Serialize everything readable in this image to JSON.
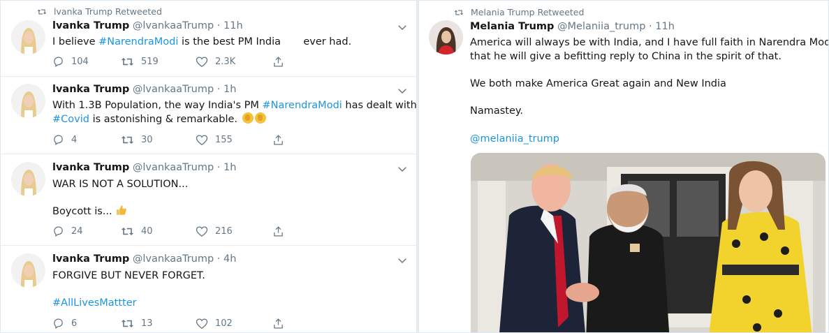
{
  "left_column": {
    "tweets": [
      {
        "retweet_label": "lvanka Trump Retweeted",
        "name": "lvanka Trump",
        "handle": "@lvankaaTrump",
        "dot": "·",
        "time": "11h",
        "text_before": "I believe ",
        "hashtag1": "#NarendraModi",
        "text_after": " is the best PM India       ever had.",
        "replies": "104",
        "retweets": "519",
        "likes": "2.3K"
      },
      {
        "name": "lvanka Trump",
        "handle": "@lvankaaTrump",
        "dot": "·",
        "time": "1h",
        "line1_before": "With 1.3B Population, the way India's PM ",
        "hashtag1": "#NarendraModi",
        "line1_after": " has dealt with",
        "hashtag2": "#Covid",
        "line2_after": " is astonishing & remarkable. ",
        "replies": "4",
        "retweets": "30",
        "likes": "155"
      },
      {
        "name": "lvanka Trump",
        "handle": "@lvankaaTrump",
        "dot": "·",
        "time": "1h",
        "line1": "WAR IS NOT A SOLUTION...",
        "line2": "Boycott is... ",
        "replies": "24",
        "retweets": "40",
        "likes": "216"
      },
      {
        "name": "lvanka Trump",
        "handle": "@lvankaaTrump",
        "dot": "·",
        "time": "4h",
        "line1": "FORGIVE BUT NEVER FORGET.",
        "hashtag1": "#AllLivesMattter",
        "replies": "6",
        "retweets": "13",
        "likes": "102"
      }
    ]
  },
  "right_column": {
    "retweet_label": "Melania Trump Retweeted",
    "name": "Melania Trump",
    "handle": "@Melaniia_trump",
    "dot": "·",
    "time": "11h",
    "line1": "America will always be with India, and I have full faith in Narendra Modi",
    "line2": "that he will give a befitting reply to China in the spirit of that.",
    "line3": "We both make America Great again and New India",
    "line4": "Namastey.",
    "mention": "@melaniia_trump"
  },
  "colors": {
    "link": "#1b95e0",
    "secondary_text": "#657786",
    "divider": "#e6ecf0"
  },
  "icons": [
    "retweet-icon",
    "reply-icon",
    "like-icon",
    "share-icon",
    "chevron-down-icon",
    "clap-emoji-icon",
    "thumbs-up-emoji-icon"
  ]
}
